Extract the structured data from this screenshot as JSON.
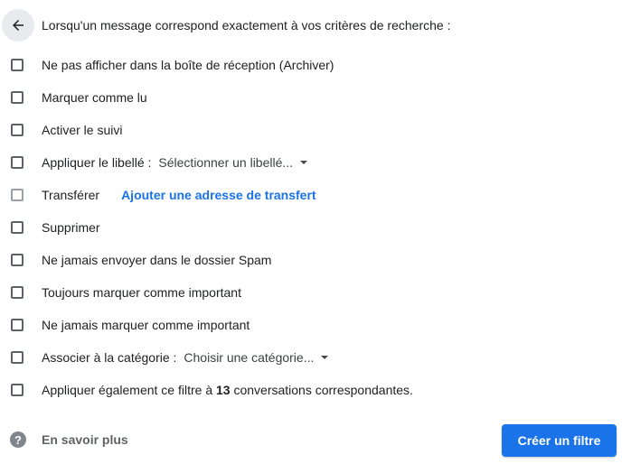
{
  "header": {
    "back_icon": "arrow-left-icon",
    "text": "Lorsqu'un message correspond exactement à vos critères de recherche :"
  },
  "options": {
    "archive": "Ne pas afficher dans la boîte de réception (Archiver)",
    "mark_read": "Marquer comme lu",
    "star": "Activer le suivi",
    "apply_label": "Appliquer le libellé :",
    "label_select": "Sélectionner un libellé...",
    "forward": "Transférer",
    "forward_link": "Ajouter une adresse de transfert",
    "delete": "Supprimer",
    "never_spam": "Ne jamais envoyer dans le dossier Spam",
    "always_important": "Toujours marquer comme important",
    "never_important": "Ne jamais marquer comme important",
    "categorize": "Associer à la catégorie :",
    "category_select": "Choisir une catégorie...",
    "apply_prefix": "Appliquer également ce filtre à ",
    "apply_count": "13",
    "apply_suffix": " conversations correspondantes."
  },
  "footer": {
    "help_icon": "help-circle-icon",
    "help_glyph": "?",
    "learn_more": "En savoir plus",
    "create_button": "Créer un filtre"
  },
  "colors": {
    "primary": "#1a73e8",
    "text": "#202124",
    "checkbox_border": "#5f6368"
  }
}
